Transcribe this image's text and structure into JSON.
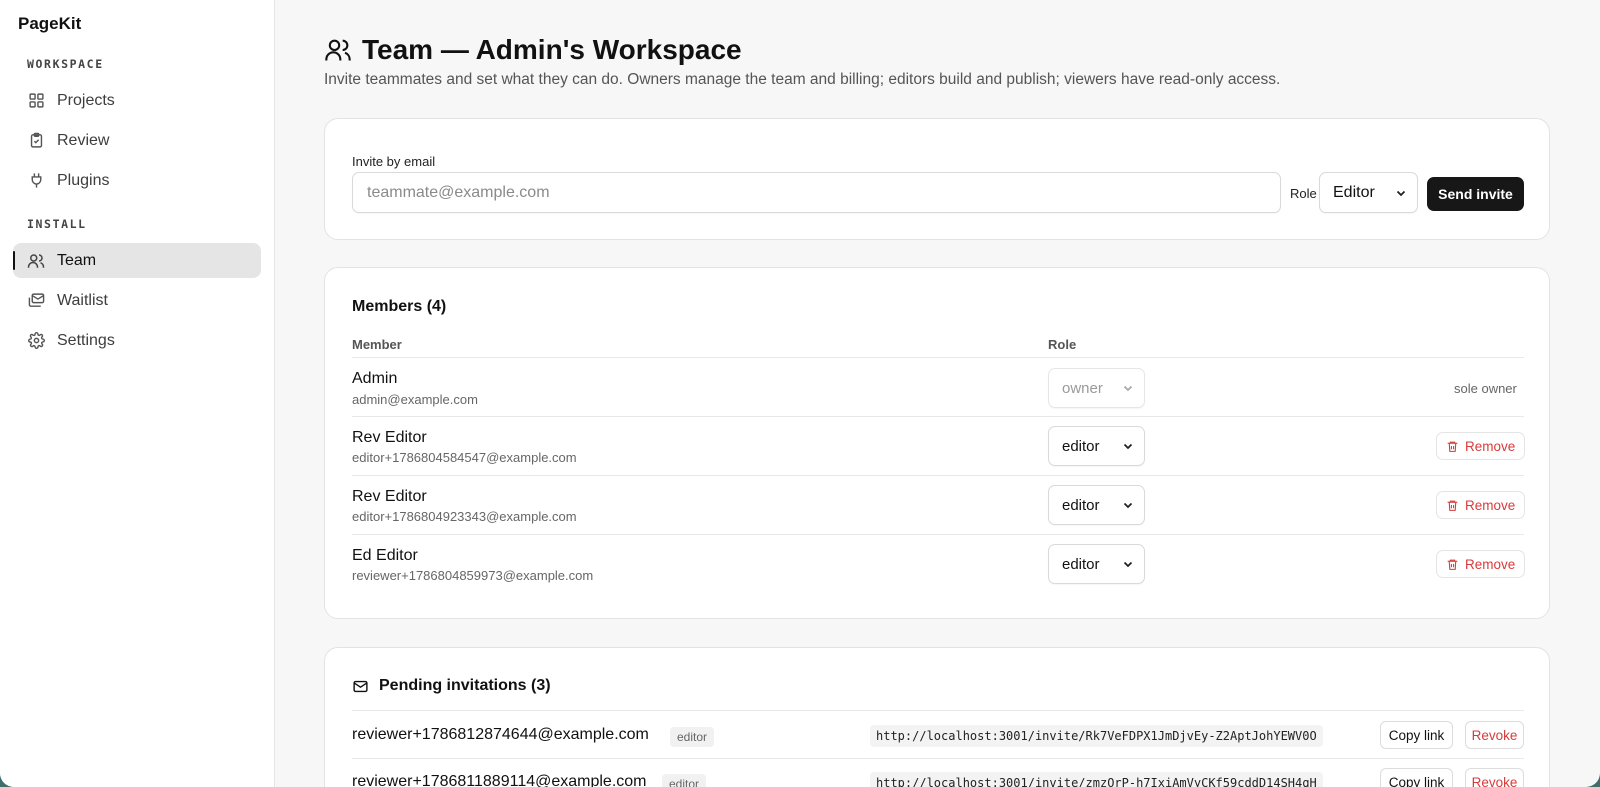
{
  "app": {
    "name": "PageKit"
  },
  "sidebar": {
    "sections": [
      {
        "label": "WORKSPACE"
      },
      {
        "label": "INSTALL"
      }
    ],
    "items": [
      {
        "label": "Projects",
        "icon": "grid-icon"
      },
      {
        "label": "Review",
        "icon": "clipboard-check-icon"
      },
      {
        "label": "Plugins",
        "icon": "plug-icon"
      },
      {
        "label": "Team",
        "icon": "users-icon",
        "active": true
      },
      {
        "label": "Waitlist",
        "icon": "mail-stack-icon"
      },
      {
        "label": "Settings",
        "icon": "gear-icon"
      }
    ]
  },
  "page": {
    "title": "Team — Admin's Workspace",
    "description": "Invite teammates and set what they can do. Owners manage the team and billing; editors build and publish; viewers have read-only access."
  },
  "invite": {
    "label": "Invite by email",
    "email_placeholder": "teammate@example.com",
    "role_label": "Role",
    "role_value": "Editor",
    "send_label": "Send invite"
  },
  "members": {
    "title": "Members (4)",
    "col_member": "Member",
    "col_role": "Role",
    "rows": [
      {
        "name": "Admin",
        "email": "admin@example.com",
        "role": "owner",
        "note": "sole owner"
      },
      {
        "name": "Rev Editor",
        "email": "editor+1786804584547@example.com",
        "role": "editor",
        "action": "Remove"
      },
      {
        "name": "Rev Editor",
        "email": "editor+1786804923343@example.com",
        "role": "editor",
        "action": "Remove"
      },
      {
        "name": "Ed Editor",
        "email": "reviewer+1786804859973@example.com",
        "role": "editor",
        "action": "Remove"
      }
    ]
  },
  "pending": {
    "title": "Pending invitations (3)",
    "rows": [
      {
        "email": "reviewer+1786812874644@example.com",
        "role": "editor",
        "link": "http://localhost:3001/invite/Rk7VeFDPX1JmDjvEy-Z2AptJohYEWV0O",
        "copy": "Copy link",
        "revoke": "Revoke"
      },
      {
        "email": "reviewer+1786811889114@example.com",
        "role": "editor",
        "link": "http://localhost:3001/invite/zmzOrP-h7IxiAmVyCKf59cddD14SH4qH",
        "copy": "Copy link",
        "revoke": "Revoke"
      }
    ]
  }
}
